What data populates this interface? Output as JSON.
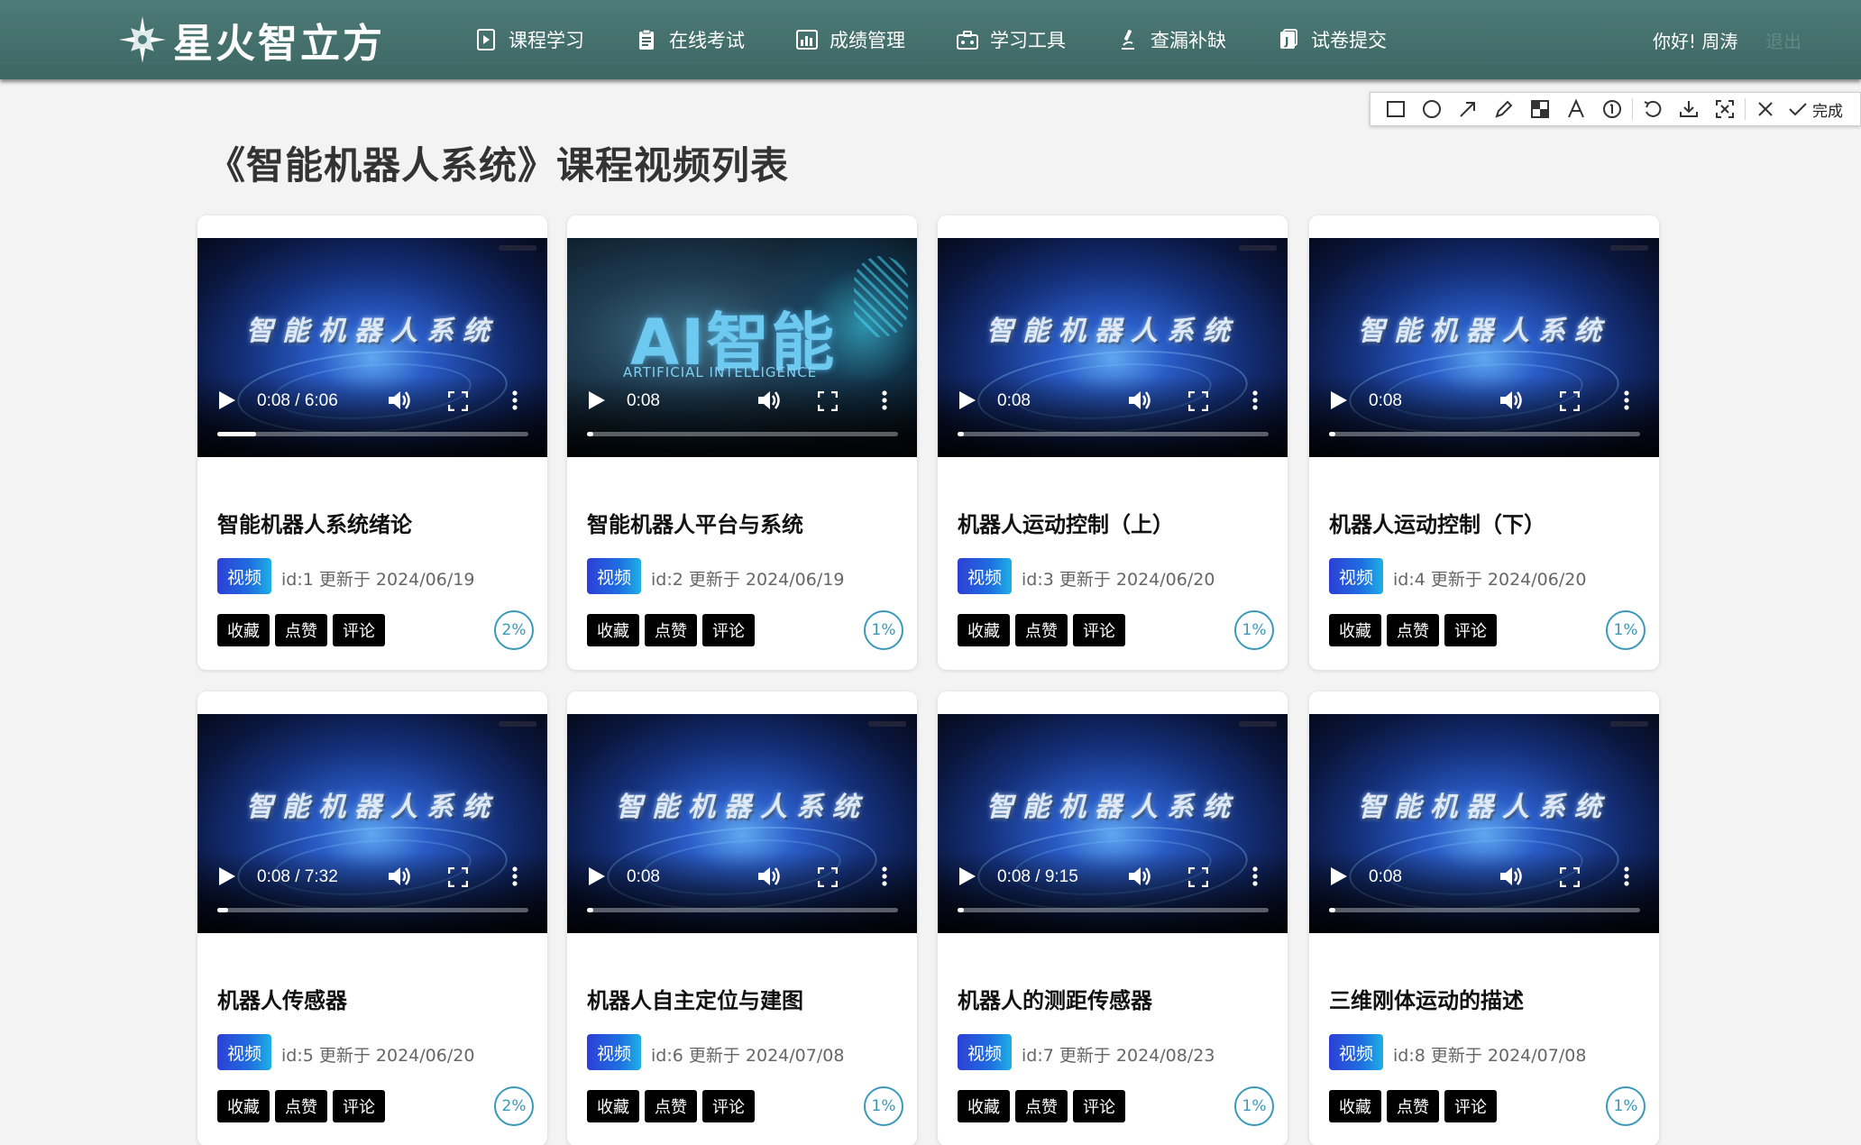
{
  "header": {
    "logo_text": "星火智立方",
    "nav": [
      {
        "label": "课程学习",
        "icon": "play-document-icon"
      },
      {
        "label": "在线考试",
        "icon": "clipboard-icon"
      },
      {
        "label": "成绩管理",
        "icon": "bar-chart-icon"
      },
      {
        "label": "学习工具",
        "icon": "toolbox-icon"
      },
      {
        "label": "查漏补缺",
        "icon": "microscope-icon"
      },
      {
        "label": "试卷提交",
        "icon": "submit-paper-icon"
      }
    ],
    "greeting": "你好! 周涛",
    "logout": "退出"
  },
  "toolbar": {
    "done_label": "完成",
    "tools": [
      "rectangle-icon",
      "circle-icon",
      "arrow-icon",
      "pencil-icon",
      "mosaic-icon",
      "text-icon",
      "number-icon",
      "undo-icon",
      "download-icon",
      "pin-icon",
      "close-icon"
    ]
  },
  "page_title": "《智能机器人系统》课程视频列表",
  "video_overlay_title": "智能机器人系统",
  "ai_thumbnail": {
    "big_text": "AI智能",
    "sub_text": "ARTIFICIAL INTELLIGENCE"
  },
  "action_labels": {
    "favorite": "收藏",
    "like": "点赞",
    "comment": "评论"
  },
  "badge_label": "视频",
  "cards": [
    {
      "title": "智能机器人系统绪论",
      "meta": "id:1 更新于 2024/06/19",
      "time": "0:08 / 6:06",
      "progress": 0.125,
      "percent": "2%",
      "thumbnail": "series"
    },
    {
      "title": "智能机器人平台与系统",
      "meta": "id:2 更新于 2024/06/19",
      "time": "0:08",
      "progress": 0.02,
      "percent": "1%",
      "thumbnail": "ai"
    },
    {
      "title": "机器人运动控制（上）",
      "meta": "id:3 更新于 2024/06/20",
      "time": "0:08",
      "progress": 0.02,
      "percent": "1%",
      "thumbnail": "series"
    },
    {
      "title": "机器人运动控制（下）",
      "meta": "id:4 更新于 2024/06/20",
      "time": "0:08",
      "progress": 0.02,
      "percent": "1%",
      "thumbnail": "series"
    },
    {
      "title": "机器人传感器",
      "meta": "id:5 更新于 2024/06/20",
      "time": "0:08 / 7:32",
      "progress": 0.035,
      "percent": "2%",
      "thumbnail": "series"
    },
    {
      "title": "机器人自主定位与建图",
      "meta": "id:6 更新于 2024/07/08",
      "time": "0:08",
      "progress": 0.02,
      "percent": "1%",
      "thumbnail": "series"
    },
    {
      "title": "机器人的测距传感器",
      "meta": "id:7 更新于 2024/08/23",
      "time": "0:08 / 9:15",
      "progress": 0.02,
      "percent": "1%",
      "thumbnail": "series"
    },
    {
      "title": "三维刚体运动的描述",
      "meta": "id:8 更新于 2024/07/08",
      "time": "0:08",
      "progress": 0.02,
      "percent": "1%",
      "thumbnail": "series"
    }
  ]
}
